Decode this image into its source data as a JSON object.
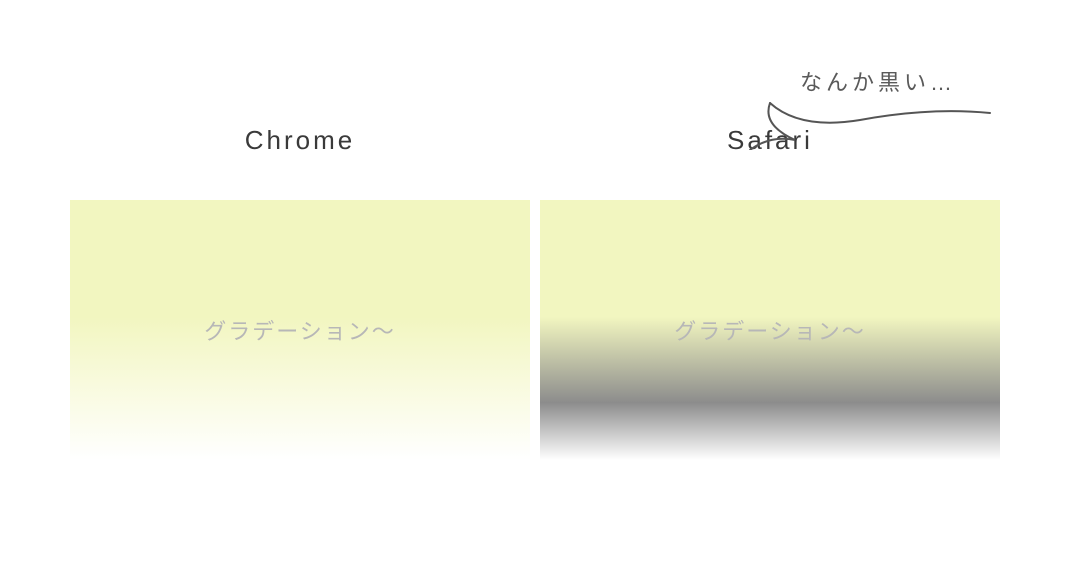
{
  "panels": {
    "chrome": {
      "title": "Chrome",
      "box_text": "グラデーション〜"
    },
    "safari": {
      "title": "Safari",
      "box_text": "グラデーション〜"
    }
  },
  "callout": {
    "text": "なんか黒い…"
  },
  "colors": {
    "pale_yellow": "#f2f6c0",
    "text_gray": "#b7b7b7",
    "title_gray": "#3a3a3a"
  }
}
